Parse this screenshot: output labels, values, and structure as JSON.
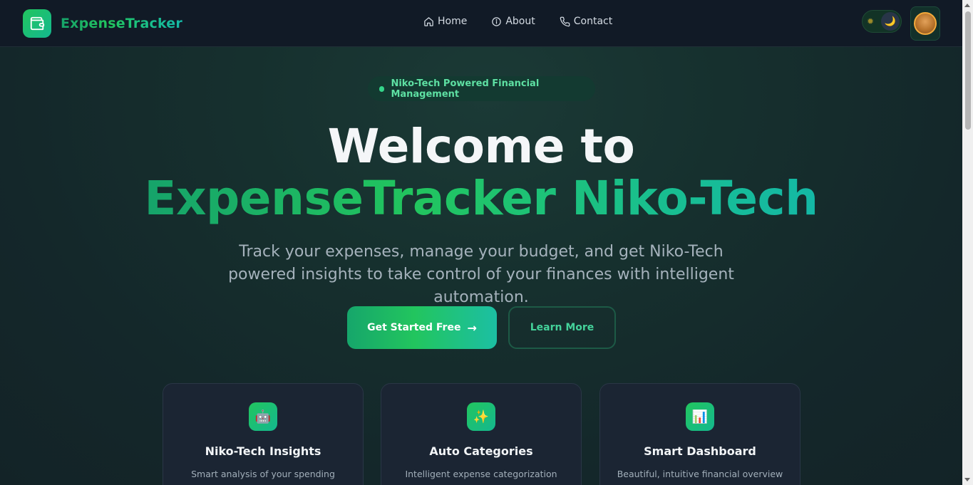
{
  "brand": {
    "name": "ExpenseTracker",
    "logo_icon": "wallet-icon"
  },
  "nav": {
    "links": [
      {
        "label": "Home",
        "icon": "home-icon"
      },
      {
        "label": "About",
        "icon": "info-icon"
      },
      {
        "label": "Contact",
        "icon": "phone-icon"
      }
    ]
  },
  "theme_toggle": {
    "light_icon": "sun-icon",
    "dark_icon": "moon-icon",
    "sun_glyph": "✹",
    "moon_glyph": "🌙",
    "mode": "dark"
  },
  "hero": {
    "badge": "Niko-Tech Powered Financial Management",
    "title_line1": "Welcome to",
    "title_line2": "ExpenseTracker Niko-Tech",
    "subtitle": "Track your expenses, manage your budget, and get Niko-Tech powered insights to take control of your finances with intelligent automation.",
    "primary_button": "Get Started Free",
    "primary_arrow": "→",
    "secondary_button": "Learn More"
  },
  "features": [
    {
      "icon": "robot-icon",
      "glyph": "🤖",
      "title": "Niko-Tech Insights",
      "description": "Smart analysis of your spending"
    },
    {
      "icon": "sparkles-icon",
      "glyph": "✨",
      "title": "Auto Categories",
      "description": "Intelligent expense categorization"
    },
    {
      "icon": "chart-icon",
      "glyph": "📊",
      "title": "Smart Dashboard",
      "description": "Beautiful, intuitive financial overview"
    }
  ],
  "colors": {
    "accent_green": "#22c55e",
    "accent_teal": "#14b8a6",
    "navbar_bg": "#111a26",
    "card_bg": "#1b2533"
  }
}
